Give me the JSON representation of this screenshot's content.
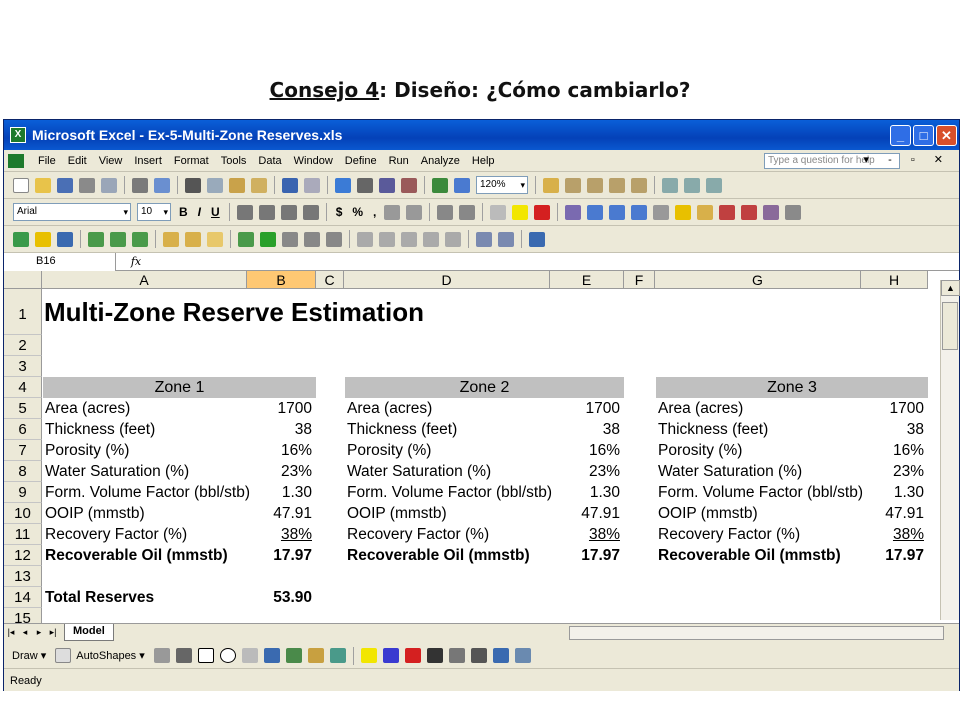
{
  "slide": {
    "title_underlined": "Consejo 4",
    "title_rest": ": Diseño: ¿Cómo cambiarlo?"
  },
  "window": {
    "title": "Microsoft Excel - Ex-5-Multi-Zone Reserves.xls",
    "min": "_",
    "max": "□",
    "close": "✕"
  },
  "menu": {
    "items": [
      "File",
      "Edit",
      "View",
      "Insert",
      "Format",
      "Tools",
      "Data",
      "Window",
      "Define",
      "Run",
      "Analyze",
      "Help"
    ],
    "help_placeholder": "Type a question for help",
    "mdi_controls": "▾ - ▫ ✕"
  },
  "toolbar": {
    "zoom": "120%",
    "font": "Arial",
    "size": "10",
    "bold": "B",
    "italic": "I",
    "underline": "U",
    "currency": "$",
    "percent": "%",
    "comma": ","
  },
  "formula_bar": {
    "namebox": "B16",
    "fx": "fx",
    "value": ""
  },
  "columns": [
    {
      "label": "",
      "width": 38
    },
    {
      "label": "A",
      "width": 205
    },
    {
      "label": "B",
      "width": 69
    },
    {
      "label": "C",
      "width": 28
    },
    {
      "label": "D",
      "width": 206
    },
    {
      "label": "E",
      "width": 74
    },
    {
      "label": "F",
      "width": 31
    },
    {
      "label": "G",
      "width": 206
    },
    {
      "label": "H",
      "width": 67
    }
  ],
  "rows": [
    "1",
    "2",
    "3",
    "4",
    "5",
    "6",
    "7",
    "8",
    "9",
    "10",
    "11",
    "12",
    "13",
    "14",
    "15"
  ],
  "sheet": {
    "title": "Multi-Zone Reserve Estimation",
    "zones": [
      {
        "name": "Zone 1",
        "values": [
          "1700",
          "38",
          "16%",
          "23%",
          "1.30",
          "47.91",
          "38%",
          "17.97"
        ]
      },
      {
        "name": "Zone 2",
        "values": [
          "1700",
          "38",
          "16%",
          "23%",
          "1.30",
          "47.91",
          "38%",
          "17.97"
        ]
      },
      {
        "name": "Zone 3",
        "values": [
          "1700",
          "38",
          "16%",
          "23%",
          "1.30",
          "47.91",
          "38%",
          "17.97"
        ]
      }
    ],
    "labels": [
      "Area (acres)",
      "Thickness (feet)",
      "Porosity (%)",
      "Water Saturation (%)",
      "Form. Volume Factor (bbl/stb)",
      "OOIP (mmstb)",
      "Recovery Factor (%)",
      "Recoverable Oil (mmstb)"
    ],
    "total_label": "Total Reserves",
    "total_value": "53.90"
  },
  "tabs": {
    "active": "Model"
  },
  "drawing": {
    "draw": "Draw ▾",
    "autoshapes": "AutoShapes ▾"
  },
  "status": "Ready"
}
